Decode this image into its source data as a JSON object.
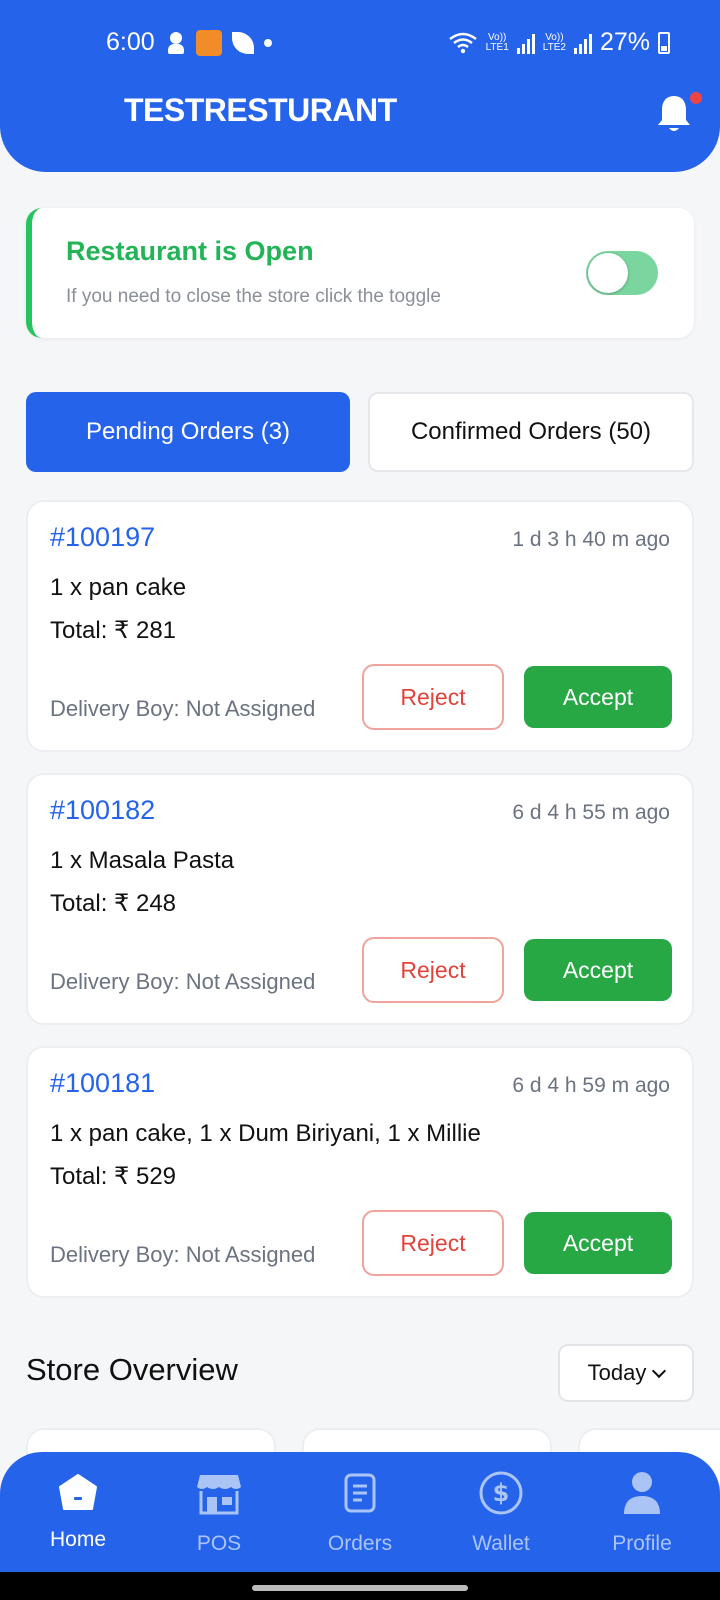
{
  "status_bar": {
    "time": "6:00",
    "battery": "27%",
    "sim1_label": "LTE1",
    "sim2_label": "LTE2"
  },
  "header": {
    "title": "TESTRESTURANT",
    "notification_icon": "bell-icon"
  },
  "store_status": {
    "title": "Restaurant is Open",
    "subtitle": "If you need to close the store click the toggle",
    "toggle_on": true,
    "accent_color": "#22c55e"
  },
  "tabs": {
    "pending_label": "Pending Orders (3)",
    "confirmed_label": "Confirmed Orders (50)",
    "active": "pending"
  },
  "orders": [
    {
      "id": "#100197",
      "time_ago": "1 d 3 h 40 m ago",
      "items": "1 x pan cake",
      "total": "Total: ₹ 281",
      "delivery": "Delivery Boy: Not Assigned",
      "reject_label": "Reject",
      "accept_label": "Accept"
    },
    {
      "id": "#100182",
      "time_ago": "6 d 4 h 55 m ago",
      "items": "1 x Masala Pasta",
      "total": "Total: ₹ 248",
      "delivery": "Delivery Boy: Not Assigned",
      "reject_label": "Reject",
      "accept_label": "Accept"
    },
    {
      "id": "#100181",
      "time_ago": "6 d 4 h 59 m ago",
      "items": "1 x pan cake, 1 x Dum Biriyani, 1 x Millie",
      "total": "Total: ₹ 529",
      "delivery": "Delivery Boy: Not Assigned",
      "reject_label": "Reject",
      "accept_label": "Accept"
    }
  ],
  "overview": {
    "title": "Store Overview",
    "period": "Today"
  },
  "bottom_nav": {
    "items": [
      {
        "label": "Home",
        "icon": "home-icon",
        "active": true
      },
      {
        "label": "POS",
        "icon": "store-icon",
        "active": false
      },
      {
        "label": "Orders",
        "icon": "document-icon",
        "active": false
      },
      {
        "label": "Wallet",
        "icon": "dollar-icon",
        "active": false
      },
      {
        "label": "Profile",
        "icon": "user-icon",
        "active": false
      }
    ]
  },
  "colors": {
    "primary": "#2563eb",
    "accept": "#28a745",
    "reject": "#e0443a",
    "open_green": "#22b457"
  }
}
